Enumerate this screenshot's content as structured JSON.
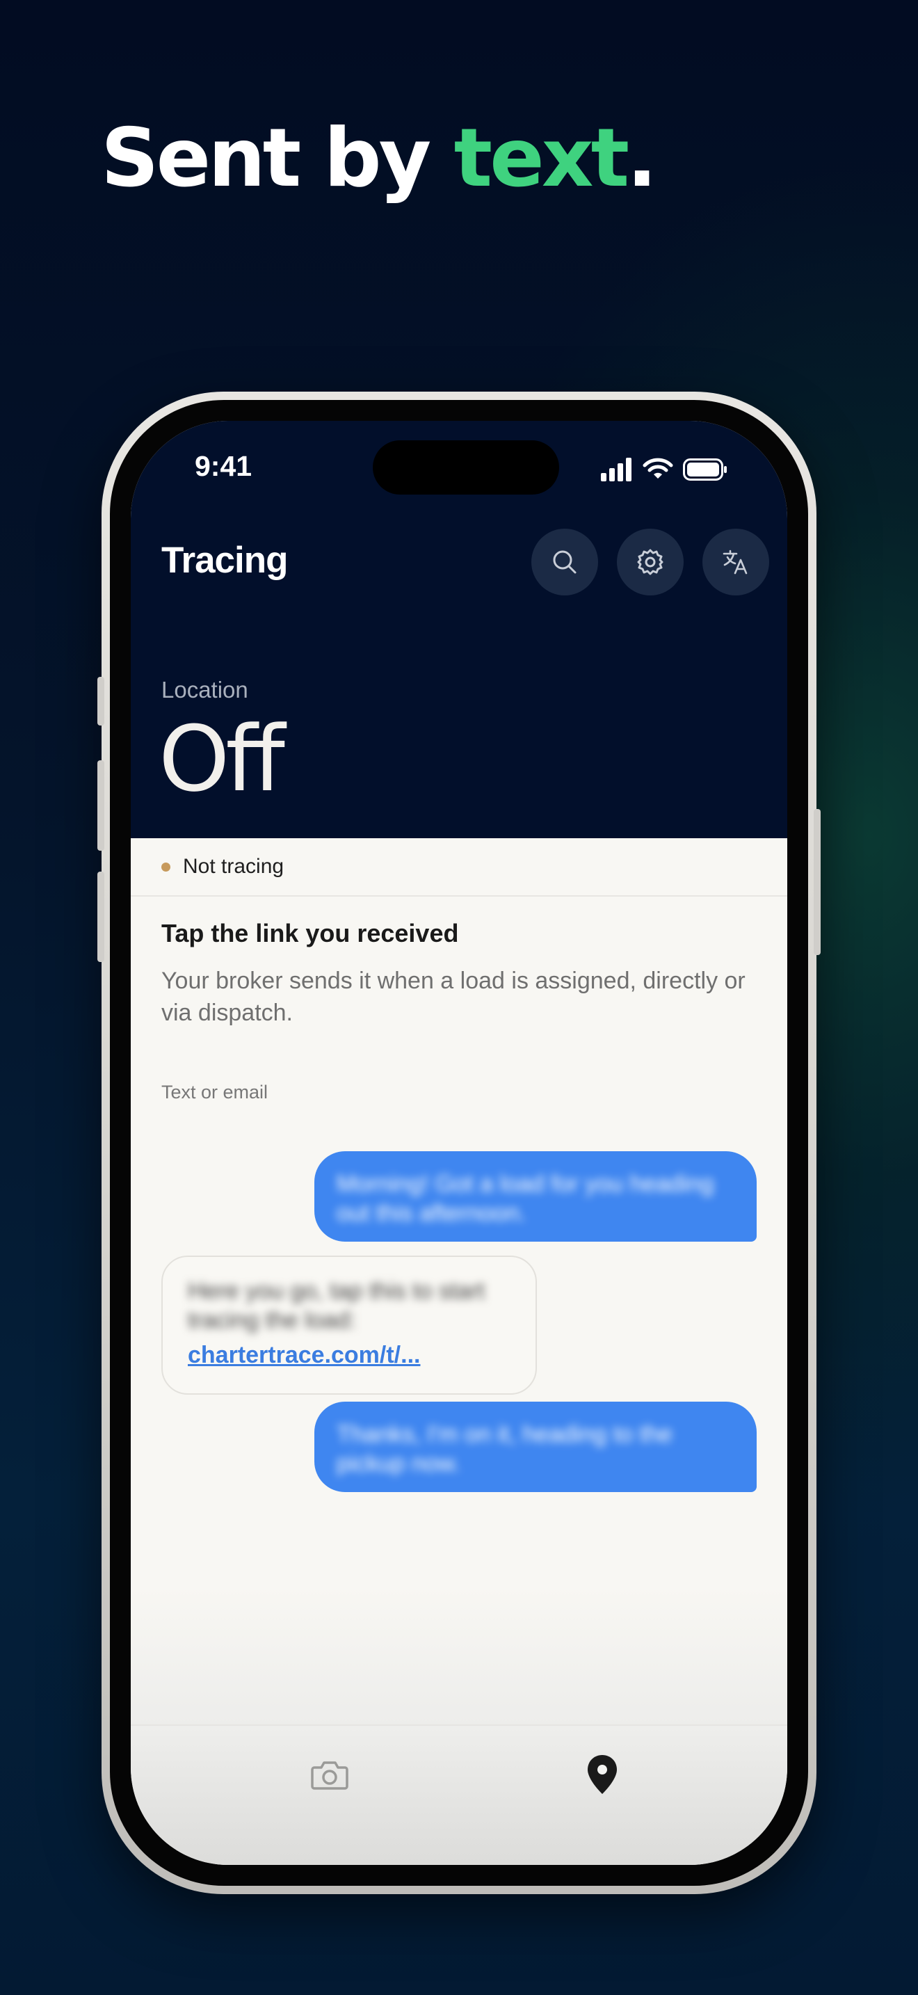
{
  "headline": {
    "prefix": "Sent by ",
    "accent": "text",
    "suffix": ".",
    "accent_color": "#3fd27f"
  },
  "status_bar": {
    "time": "9:41",
    "icons": [
      "cellular-signal-icon",
      "wifi-icon",
      "battery-icon"
    ]
  },
  "header": {
    "title": "Tracing",
    "buttons": [
      "search-icon",
      "gear-icon",
      "translate-icon"
    ]
  },
  "location": {
    "label": "Location",
    "value": "Off"
  },
  "tracing_status": {
    "text": "Not tracing",
    "dot_color": "#c79a5c"
  },
  "instructions": {
    "title": "Tap the link you received",
    "description": "Your broker sends it when a load is assigned, directly or via dispatch."
  },
  "messages": {
    "label": "Text or email",
    "items": [
      {
        "direction": "outgoing",
        "text": "Morning! Got a load for you heading out this afternoon."
      },
      {
        "direction": "incoming",
        "text": "Here you go, tap this to start tracing the load:",
        "link": "chartertrace.com/t/..."
      },
      {
        "direction": "outgoing",
        "text": "Thanks, I'm on it, heading to the pickup now."
      }
    ]
  },
  "tab_bar": {
    "tabs": [
      {
        "icon": "camera-icon",
        "active": false
      },
      {
        "icon": "location-pin-icon",
        "active": true
      }
    ]
  },
  "colors": {
    "header_bg": "#020f2b",
    "content_bg": "#f8f7f3",
    "bubble_blue": "#3f86f0"
  }
}
